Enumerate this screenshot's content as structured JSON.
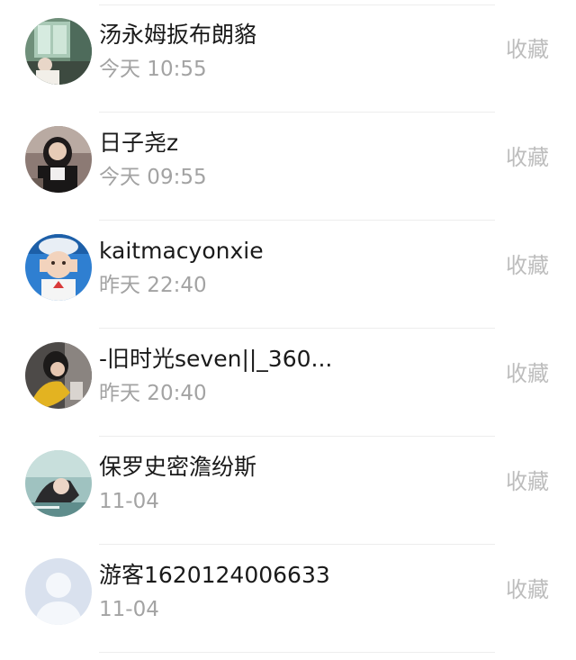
{
  "collect_label": "收藏",
  "items": [
    {
      "name": "汤永姆扳布朗貉",
      "time": "今天 10:55",
      "avatar": "photo-avatar"
    },
    {
      "name": "日子尧z",
      "time": "今天 09:55",
      "avatar": "photo-avatar"
    },
    {
      "name": "kaitmacyonxie",
      "time": "昨天 22:40",
      "avatar": "photo-avatar"
    },
    {
      "name": "-旧时光seven||_360...",
      "time": "昨天 20:40",
      "avatar": "photo-avatar"
    },
    {
      "name": "保罗史密澹纷斯",
      "time": "11-04",
      "avatar": "photo-avatar"
    },
    {
      "name": "游客1620124006633",
      "time": "11-04",
      "avatar": "default-user-icon"
    }
  ]
}
